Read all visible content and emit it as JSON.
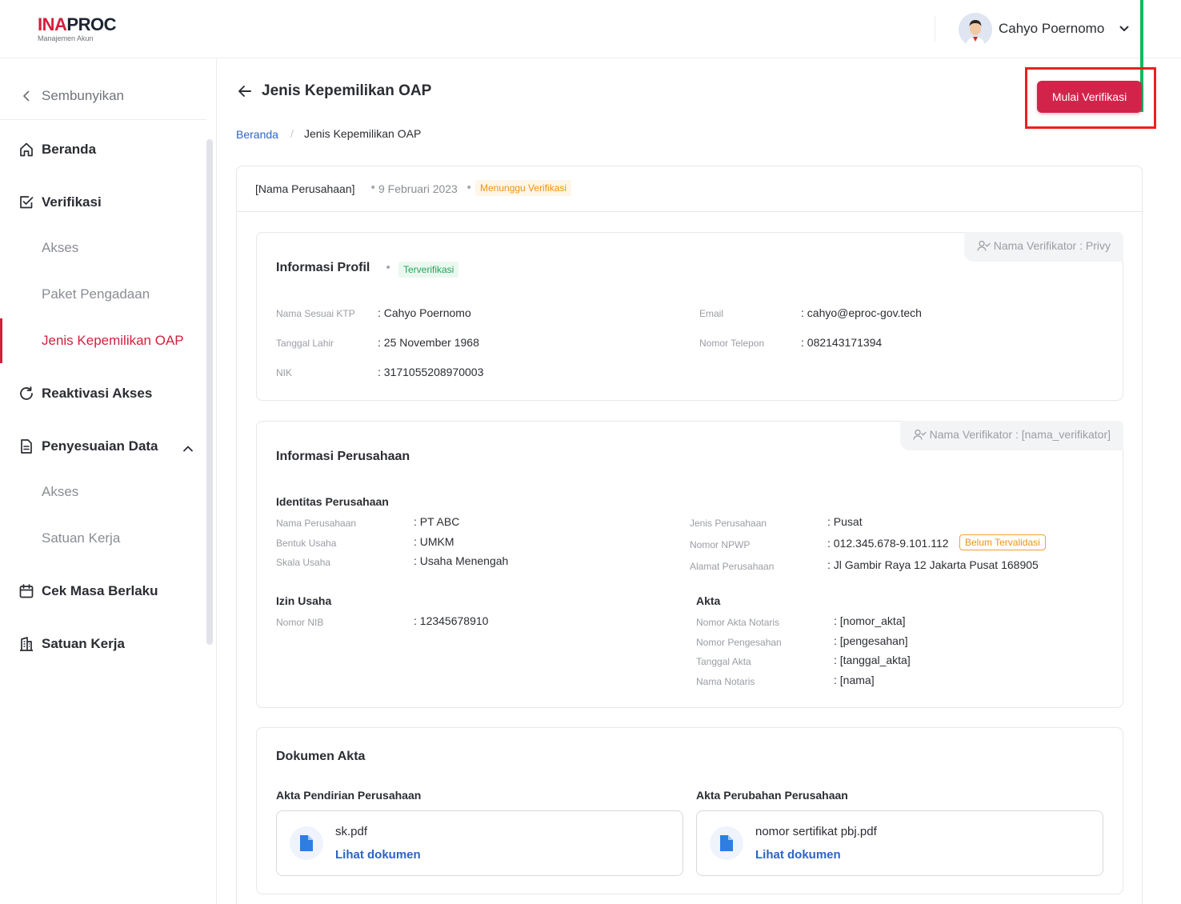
{
  "app": {
    "logo_primary": "INA",
    "logo_secondary": "PROC",
    "logo_sub": "Manajemen Akun"
  },
  "header": {
    "user_name": "Cahyo Poernomo"
  },
  "sidebar": {
    "hide_label": "Sembunyikan",
    "items": [
      {
        "label": "Beranda",
        "icon": "home-icon"
      },
      {
        "label": "Verifikasi",
        "icon": "check-square-icon"
      },
      {
        "label": "Akses"
      },
      {
        "label": "Paket Pengadaan"
      },
      {
        "label": "Jenis Kepemilikan OAP",
        "active": true
      },
      {
        "label": "Reaktivasi Akses",
        "icon": "refresh-icon"
      },
      {
        "label": "Penyesuaian Data",
        "icon": "document-icon"
      },
      {
        "label": "Akses"
      },
      {
        "label": "Satuan Kerja"
      },
      {
        "label": "Cek Masa Berlaku",
        "icon": "calendar-icon"
      },
      {
        "label": "Satuan Kerja",
        "icon": "building-icon"
      }
    ]
  },
  "page": {
    "title": "Jenis Kepemilikan OAP",
    "action_button": "Mulai Verifikasi",
    "breadcrumb_home": "Beranda",
    "breadcrumb_sep": "/",
    "breadcrumb_current": "Jenis Kepemilikan OAP"
  },
  "summary": {
    "company": "[Nama Perusahaan]",
    "dot": "•",
    "date": "9 Februari 2023",
    "status": "Menunggu Verifikasi"
  },
  "profile": {
    "title": "Informasi Profil",
    "status": "Terverifikasi",
    "verifier": "Nama Verifikator : Privy",
    "fields": [
      {
        "label": "Nama Sesuai KTP",
        "value": ": Cahyo Poernomo"
      },
      {
        "label": "Tanggal Lahir",
        "value": ": 25 November 1968"
      },
      {
        "label": "NIK",
        "value": ": 3171055208970003"
      },
      {
        "label": "Email",
        "value": ": cahyo@eproc-gov.tech"
      },
      {
        "label": "Nomor Telepon",
        "value": ": 082143171394"
      }
    ]
  },
  "company": {
    "title": "Informasi Perusahaan",
    "verifier": "Nama Verifikator : [nama_verifikator]",
    "identity_title": "Identitas Perusahaan",
    "identity": [
      {
        "label": "Nama Perusahaan",
        "value": ": PT ABC"
      },
      {
        "label": "Bentuk Usaha",
        "value": ": UMKM"
      },
      {
        "label": "Skala Usaha",
        "value": ": Usaha Menengah"
      },
      {
        "label": "Jenis Perusahaan",
        "value": ": Pusat"
      },
      {
        "label": "Nomor NPWP",
        "value": ": 012.345.678-9.101.112"
      },
      {
        "label": "Alamat Perusahaan",
        "value": ": Jl Gambir Raya 12 Jakarta Pusat 168905"
      }
    ],
    "npwp_badge": "Belum Tervalidasi",
    "license_title": "Izin Usaha",
    "license": [
      {
        "label": "Nomor NIB",
        "value": ": 12345678910"
      }
    ],
    "deed_title": "Akta",
    "deed": [
      {
        "label": "Nomor Akta Notaris",
        "value": ": [nomor_akta]"
      },
      {
        "label": "Nomor Pengesahan",
        "value": ": [pengesahan]"
      },
      {
        "label": "Tanggal Akta",
        "value": ": [tanggal_akta]"
      },
      {
        "label": "Nama Notaris",
        "value": ": [nama]"
      }
    ]
  },
  "documents": {
    "title": "Dokumen Akta",
    "items": [
      {
        "heading": "Akta Pendirian Perusahaan",
        "file": "sk.pdf",
        "link": "Lihat dokumen"
      },
      {
        "heading": "Akta Perubahan Perusahaan",
        "file": "nomor sertifikat pbj.pdf",
        "link": "Lihat dokumen"
      }
    ]
  },
  "colors": {
    "brand": "#d21f3c",
    "link": "#2c64c8",
    "success": "#21a55a",
    "warning": "#f0930e"
  }
}
